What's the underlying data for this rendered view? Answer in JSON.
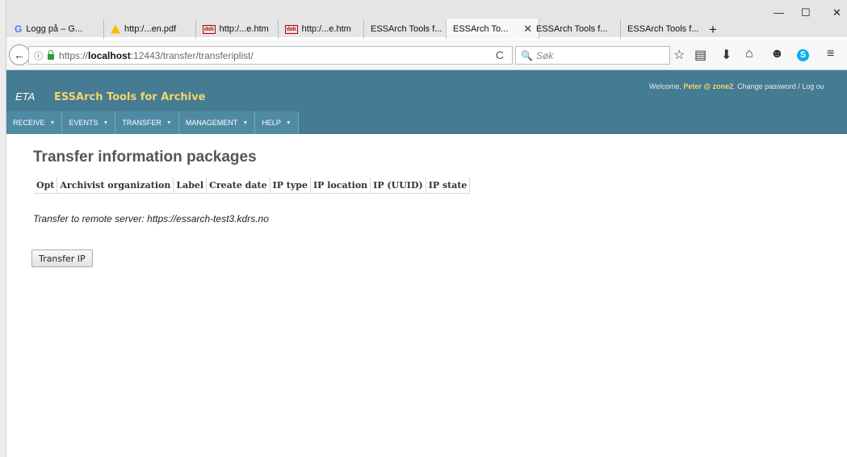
{
  "browser": {
    "tabs": [
      {
        "label": "Logg på – G...",
        "icon": "google-icon"
      },
      {
        "label": "http:/...en.pdf",
        "icon": "warning-icon"
      },
      {
        "label": "http:/...e.htm",
        "icon": "cisco-icon"
      },
      {
        "label": "http:/...e.htm",
        "icon": "cisco-icon"
      },
      {
        "label": "ESSArch Tools f...",
        "icon": ""
      },
      {
        "label": "ESSArch To...",
        "icon": "",
        "active": true
      },
      {
        "label": "ESSArch Tools f...",
        "icon": ""
      },
      {
        "label": "ESSArch Tools f...",
        "icon": ""
      }
    ],
    "url_prefix": "https://",
    "url_host": "localhost",
    "url_rest": ":12443/transfer/transferiplist/",
    "search_placeholder": "Søk",
    "glyphs": {
      "back": "←",
      "info": "ⓘ",
      "reload": "C",
      "search": "🔍",
      "new_tab": "+",
      "close_tab": "✕",
      "minimize": "—",
      "maximize": "☐",
      "close": "✕",
      "star": "☆",
      "reader": "▤",
      "download": "⬇",
      "home": "⌂",
      "pocket": "☻",
      "skype": "S",
      "menu": "≡"
    }
  },
  "app": {
    "eta_label": "ETA",
    "title": "ESSArch Tools for Archive",
    "welcome_prefix": "Welcome, ",
    "welcome_user": "Peter @ zone2",
    "welcome_suffix": ". Change password / Log ou",
    "menu": [
      {
        "label": "RECEIVE"
      },
      {
        "label": "EVENTS"
      },
      {
        "label": "TRANSFER"
      },
      {
        "label": "MANAGEMENT"
      },
      {
        "label": "HELP"
      }
    ],
    "caret": "▼"
  },
  "main": {
    "page_title": "Transfer information packages",
    "table_headers": [
      "Opt",
      "Archivist organization",
      "Label",
      "Create date",
      "IP type",
      "IP location",
      "IP (UUID)",
      "IP state"
    ],
    "remote_text": "Transfer to remote server: https://essarch-test3.kdrs.no",
    "transfer_button": "Transfer IP"
  }
}
